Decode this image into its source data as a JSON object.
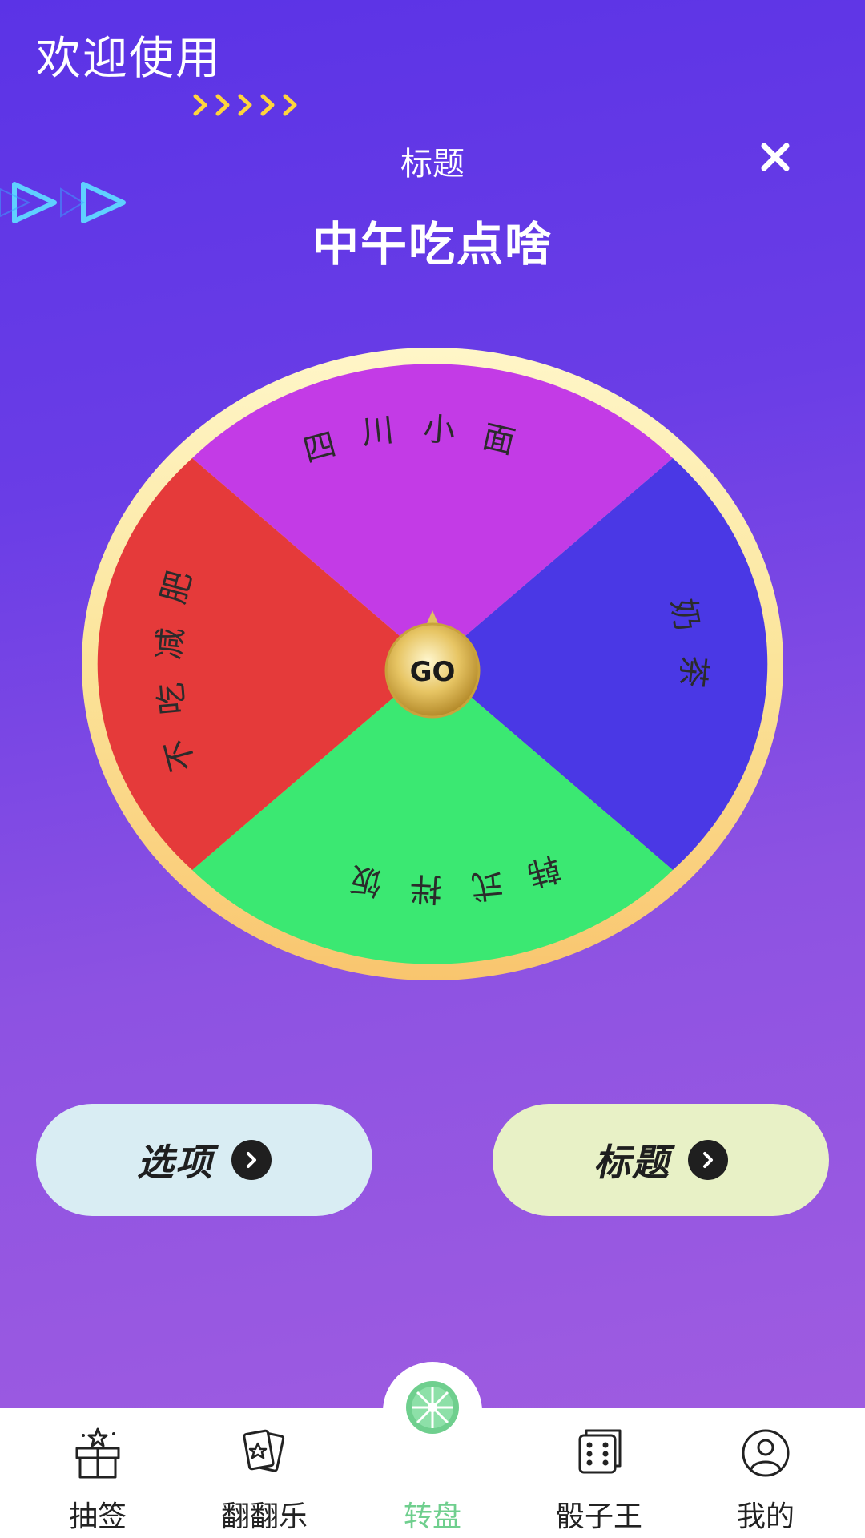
{
  "header": {
    "welcome": "欢迎使用",
    "subtitle_label": "标题",
    "title": "中午吃点啥"
  },
  "wheel": {
    "go_label": "GO",
    "segments": [
      {
        "label": "四川小面",
        "color": "#c33be6"
      },
      {
        "label": "奶茶",
        "color": "#4a38e5"
      },
      {
        "label": "韩式拌饭",
        "color": "#3be872"
      },
      {
        "label": "不吃减肥",
        "color": "#e53a3a"
      }
    ],
    "rim_color": "#fbe49a"
  },
  "buttons": {
    "options_label": "选项",
    "title_label": "标题"
  },
  "tabs": [
    {
      "label": "抽签",
      "icon": "gift-box-icon",
      "active": false
    },
    {
      "label": "翻翻乐",
      "icon": "cards-icon",
      "active": false
    },
    {
      "label": "转盘",
      "icon": "wheel-icon",
      "active": true
    },
    {
      "label": "骰子王",
      "icon": "dice-icon",
      "active": false
    },
    {
      "label": "我的",
      "icon": "user-icon",
      "active": false
    }
  ],
  "colors": {
    "accent_green": "#6fcf8e",
    "neon_yellow": "#ffd43b",
    "neon_blue": "#4fb8ff"
  }
}
